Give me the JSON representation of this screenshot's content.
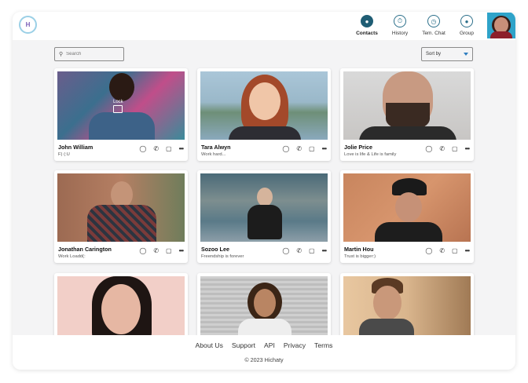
{
  "brand": {
    "logo_text": "H",
    "name": "Hichaty"
  },
  "nav": {
    "items": [
      {
        "label": "Contacts",
        "icon": "contacts-icon",
        "active": true
      },
      {
        "label": "History",
        "icon": "history-icon",
        "active": false
      },
      {
        "label": "Tem. Chat",
        "icon": "temp-chat-icon",
        "active": false
      },
      {
        "label": "Group",
        "icon": "group-icon",
        "active": false
      }
    ]
  },
  "search": {
    "placeholder": "Search"
  },
  "sort": {
    "label": "Sort by"
  },
  "contacts": [
    {
      "name": "John William",
      "status": "F) (:U",
      "overlay": "Lock"
    },
    {
      "name": "Tara Alwyn",
      "status": "Work hard..."
    },
    {
      "name": "Jolie Price",
      "status": "Love is life & Life is family"
    },
    {
      "name": "Jonathan Carington",
      "status": "Work Loadd(:"
    },
    {
      "name": "Sozoo Lee",
      "status": "Freendship is forever"
    },
    {
      "name": "Martin Hou",
      "status": "Trust is bigger:)"
    },
    {
      "name": "",
      "status": ""
    },
    {
      "name": "",
      "status": ""
    },
    {
      "name": "",
      "status": ""
    }
  ],
  "footer": {
    "links": [
      "About Us",
      "Support",
      "API",
      "Privacy",
      "Terms"
    ],
    "copyright": "© 2023 Hichaty"
  },
  "colors": {
    "accent": "#1f5d74",
    "background": "#f4f4f5",
    "profile_bg": "#2ea3c9"
  }
}
